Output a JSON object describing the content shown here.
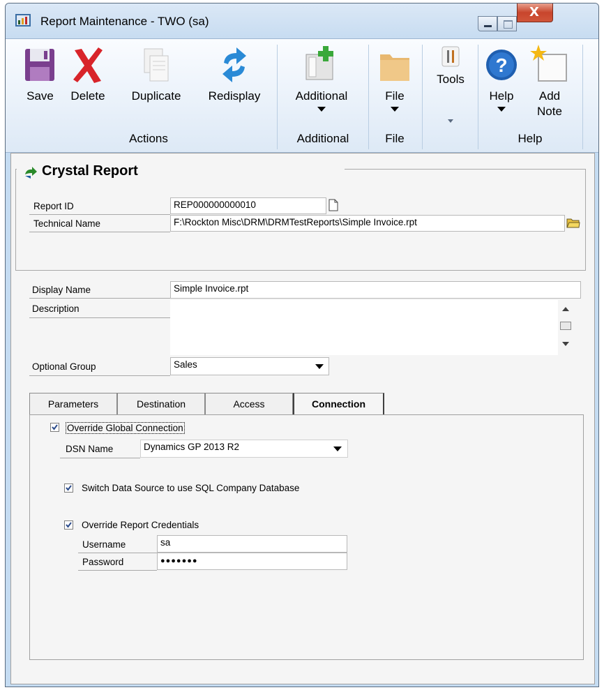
{
  "window": {
    "title": "Report Maintenance  -  TWO (sa)"
  },
  "ribbon": {
    "buttons": {
      "save": "Save",
      "delete": "Delete",
      "duplicate": "Duplicate",
      "redisplay": "Redisplay",
      "additional": "Additional",
      "file": "File",
      "tools": "Tools",
      "help": "Help",
      "add_note_1": "Add",
      "add_note_2": "Note"
    },
    "groups": {
      "actions": "Actions",
      "additional": "Additional",
      "file": "File",
      "help": "Help"
    }
  },
  "header": {
    "title": "Crystal Report"
  },
  "form": {
    "report_id_label": "Report ID",
    "report_id_value": "REP000000000010",
    "technical_name_label": "Technical Name",
    "technical_name_value": "F:\\Rockton Misc\\DRM\\DRMTestReports\\Simple Invoice.rpt",
    "display_name_label": "Display Name",
    "display_name_value": "Simple Invoice.rpt",
    "description_label": "Description",
    "description_value": "",
    "optional_group_label": "Optional Group",
    "optional_group_value": "Sales"
  },
  "tabs": [
    {
      "label": "Parameters"
    },
    {
      "label": "Destination"
    },
    {
      "label": "Access"
    },
    {
      "label": "Connection"
    }
  ],
  "connection": {
    "override_global_label": "Override Global Connection",
    "override_global_checked": true,
    "dsn_label": "DSN Name",
    "dsn_value": "Dynamics GP 2013 R2",
    "switch_source_label": "Switch Data Source to use SQL Company Database",
    "switch_source_checked": true,
    "override_credentials_label": "Override Report Credentials",
    "override_credentials_checked": true,
    "username_label": "Username",
    "username_value": "sa",
    "password_label": "Password",
    "password_value": "●●●●●●●"
  }
}
